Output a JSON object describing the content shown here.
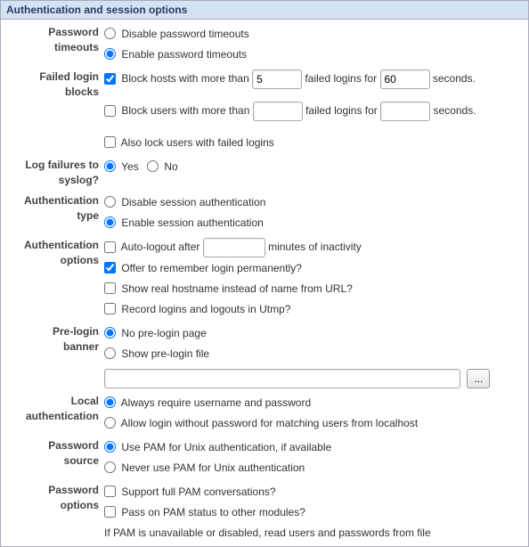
{
  "panel": {
    "title": "Authentication and session options"
  },
  "pw_timeouts": {
    "label_l1": "Password",
    "label_l2": "timeouts",
    "opt_disable": "Disable password timeouts",
    "opt_enable": "Enable password timeouts"
  },
  "failed_login": {
    "label_l1": "Failed login",
    "label_l2": "blocks",
    "block_hosts_pre": "Block hosts with more than",
    "block_hosts_mid": "failed logins for",
    "block_hosts_post": "seconds.",
    "hosts_count": "5",
    "hosts_seconds": "60",
    "block_users_pre": "Block users with more than",
    "block_users_mid": "failed logins for",
    "block_users_post": "seconds.",
    "users_count": "",
    "users_seconds": "",
    "also_lock": "Also lock users with failed logins"
  },
  "syslog": {
    "label_l1": "Log failures to",
    "label_l2": "syslog?",
    "yes": "Yes",
    "no": "No"
  },
  "auth_type": {
    "label_l1": "Authentication",
    "label_l2": "type",
    "disable": "Disable session authentication",
    "enable": "Enable session authentication"
  },
  "auth_opts": {
    "label_l1": "Authentication",
    "label_l2": "options",
    "auto_logout_pre": "Auto-logout after",
    "auto_logout_post": "minutes of inactivity",
    "auto_logout_val": "",
    "remember": "Offer to remember login permanently?",
    "show_hostname": "Show real hostname instead of name from URL?",
    "record_utmp": "Record logins and logouts in Utmp?"
  },
  "prelogin": {
    "label_l1": "Pre-login",
    "label_l2": "banner",
    "none": "No pre-login page",
    "show": "Show pre-login file",
    "file_val": "",
    "browse": "..."
  },
  "local_auth": {
    "label_l1": "Local",
    "label_l2": "authentication",
    "always": "Always require username and password",
    "allow": "Allow login without password for matching users from localhost"
  },
  "pw_source": {
    "label_l1": "Password",
    "label_l2": "source",
    "use_pam": "Use PAM for Unix authentication, if available",
    "never_pam": "Never use PAM for Unix authentication"
  },
  "pw_options": {
    "label_l1": "Password",
    "label_l2": "options",
    "full_pam": "Support full PAM conversations?",
    "pass_on": "Pass on PAM status to other modules?",
    "fallback": "If PAM is unavailable or disabled, read users and passwords from file"
  }
}
